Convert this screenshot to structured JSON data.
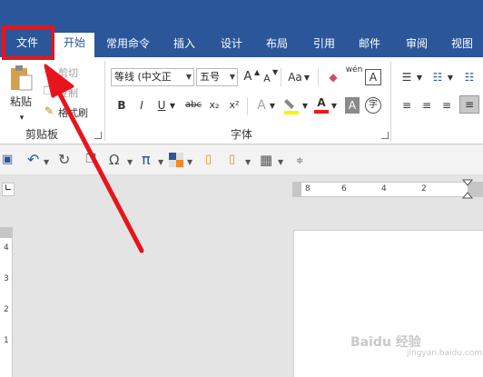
{
  "tabs": [
    "文件",
    "开始",
    "常用命令",
    "插入",
    "设计",
    "布局",
    "引用",
    "邮件",
    "审阅",
    "视图"
  ],
  "clipboard": {
    "paste": "粘贴",
    "cut": "剪切",
    "copy": "复制",
    "format_painter": "格式刷",
    "group_label": "剪贴板"
  },
  "font": {
    "name": "等线 (中文正",
    "size": "五号",
    "grow": "A",
    "shrink": "A",
    "case": "Aa",
    "group_label": "字体",
    "bold": "B",
    "italic": "I",
    "underline": "U",
    "strike": "abc",
    "sub": "x₂",
    "sup": "x²",
    "clear": "A",
    "char_border": "A",
    "enclose": "字",
    "phonetic": "wén",
    "font_color": "A"
  },
  "ruler": {
    "h_labels": [
      "8",
      "6",
      "4",
      "2"
    ],
    "v_labels": [
      "4",
      "3",
      "2",
      "1"
    ]
  },
  "watermark": "Baidu 经验",
  "watermark_sub": "jingyan.baidu.com",
  "colors": {
    "accent": "#2b579a",
    "highlight_box": "#e8141c",
    "arrow": "#e8141c"
  },
  "icons": [
    "paste-icon",
    "cut-icon",
    "copy-icon",
    "format-painter-icon",
    "save-icon",
    "undo-icon",
    "redo-icon",
    "omega-icon",
    "pi-icon",
    "color-icon",
    "table-icon",
    "bullets-icon",
    "numbering-icon",
    "align-left-icon",
    "align-center-icon",
    "align-right-icon",
    "justify-icon"
  ]
}
